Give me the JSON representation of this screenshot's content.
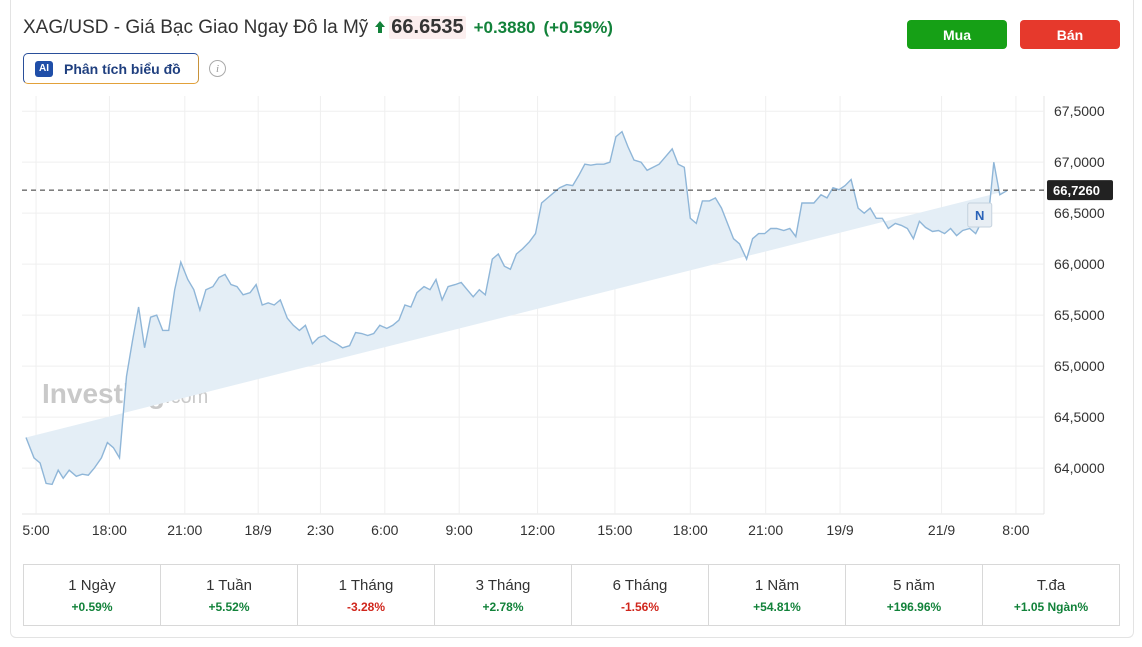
{
  "header": {
    "title": "XAG/USD - Giá Bạc Giao Ngay Đô la Mỹ",
    "price": "66.6535",
    "change": "+0.3880",
    "change_pct": "(+0.59%)",
    "buy_label": "Mua",
    "sell_label": "Bán",
    "ai_icon_text": "AI",
    "ai_label": "Phân tích biểu đồ",
    "info_icon_text": "i"
  },
  "colors": {
    "up": "#12823a",
    "down": "#d0261c",
    "line": "#8fb6d8",
    "fill": "#e4eef6",
    "buy": "#16a016",
    "sell": "#e6392c"
  },
  "chart_data": {
    "type": "area",
    "ylim": [
      63.55,
      67.6
    ],
    "yticks": [
      "67,5000",
      "67,0000",
      "66,5000",
      "66,0000",
      "65,5000",
      "65,0000",
      "64,5000",
      "64,0000"
    ],
    "ytick_values": [
      67.5,
      67.0,
      66.5,
      66.0,
      65.5,
      65.0,
      64.5,
      64.0
    ],
    "xlim": [
      0,
      100
    ],
    "xticks": [
      "5:00",
      "18:00",
      "21:00",
      "18/9",
      "2:30",
      "6:00",
      "9:00",
      "12:00",
      "15:00",
      "18:00",
      "21:00",
      "19/9",
      "21/9",
      "8:00"
    ],
    "xtick_positions": [
      1.0,
      8.3,
      15.8,
      23.1,
      29.3,
      35.7,
      43.1,
      50.9,
      58.6,
      66.1,
      73.6,
      81.0,
      91.1,
      98.5
    ],
    "current_value": "66,7260",
    "current_level": 66.726,
    "marker_label": "N",
    "grid": true,
    "watermark_main": "Investing",
    "watermark_suffix": ".com",
    "x": [
      0.0,
      0.8,
      1.4,
      2.0,
      2.6,
      3.2,
      3.7,
      4.3,
      5.0,
      5.6,
      6.2,
      6.8,
      7.5,
      8.1,
      8.7,
      9.3,
      10.0,
      10.6,
      11.2,
      11.8,
      12.4,
      13.0,
      13.6,
      14.2,
      14.8,
      15.4,
      16.1,
      16.7,
      17.3,
      17.9,
      18.6,
      19.2,
      19.8,
      20.4,
      21.0,
      21.6,
      22.3,
      22.9,
      23.5,
      24.1,
      24.7,
      25.3,
      26.0,
      26.6,
      27.2,
      27.8,
      28.5,
      29.1,
      29.7,
      30.3,
      30.9,
      31.5,
      32.2,
      32.8,
      33.4,
      34.0,
      34.6,
      35.2,
      35.9,
      36.5,
      37.1,
      37.7,
      38.3,
      38.9,
      39.6,
      40.2,
      40.8,
      41.4,
      42.0,
      42.7,
      43.3,
      43.9,
      44.5,
      45.1,
      45.7,
      46.4,
      47.0,
      47.6,
      48.2,
      48.8,
      49.4,
      50.1,
      50.7,
      51.3,
      51.9,
      52.5,
      53.1,
      53.8,
      54.4,
      55.0,
      55.6,
      56.2,
      56.8,
      57.5,
      58.1,
      58.7,
      59.3,
      59.9,
      60.5,
      61.2,
      61.8,
      62.4,
      63.0,
      63.6,
      64.3,
      64.9,
      65.5,
      66.1,
      66.7,
      67.3,
      68.0,
      68.6,
      69.2,
      69.8,
      70.4,
      71.0,
      71.7,
      72.3,
      72.9,
      73.5,
      74.1,
      74.7,
      75.4,
      76.0,
      76.6,
      77.2,
      77.8,
      78.4,
      79.1,
      79.7,
      80.3,
      80.9,
      81.5,
      82.1,
      82.8,
      83.4,
      84.0,
      84.6,
      85.2,
      85.8,
      86.5,
      87.1,
      87.7,
      88.3,
      88.9,
      89.5,
      90.2,
      90.8,
      91.4,
      92.0,
      92.6,
      93.2,
      93.9,
      94.5,
      95.1,
      95.7,
      96.3,
      96.9,
      97.6,
      98.2,
      98.8,
      99.4,
      100.0
    ],
    "y": [
      64.3,
      64.1,
      64.05,
      63.85,
      63.84,
      63.98,
      63.9,
      63.98,
      63.92,
      63.94,
      63.93,
      64.0,
      64.1,
      64.25,
      64.2,
      64.1,
      64.9,
      65.25,
      65.58,
      65.18,
      65.48,
      65.5,
      65.35,
      65.35,
      65.75,
      66.02,
      65.85,
      65.75,
      65.55,
      65.75,
      65.78,
      65.87,
      65.9,
      65.8,
      65.78,
      65.7,
      65.72,
      65.8,
      65.6,
      65.62,
      65.6,
      65.65,
      65.47,
      65.4,
      65.35,
      65.4,
      65.22,
      65.28,
      65.3,
      65.25,
      65.22,
      65.18,
      65.2,
      65.33,
      65.32,
      65.3,
      65.32,
      65.4,
      65.37,
      65.4,
      65.45,
      65.6,
      65.58,
      65.72,
      65.78,
      65.75,
      65.85,
      65.65,
      65.78,
      65.8,
      65.82,
      65.75,
      65.68,
      65.75,
      65.7,
      66.05,
      66.1,
      65.98,
      65.95,
      66.1,
      66.15,
      66.22,
      66.3,
      66.6,
      66.65,
      66.7,
      66.75,
      66.78,
      66.77,
      66.87,
      66.98,
      66.97,
      66.98,
      66.98,
      67.0,
      67.25,
      67.3,
      67.15,
      67.02,
      67.0,
      66.92,
      66.95,
      66.98,
      67.05,
      67.13,
      66.98,
      66.95,
      66.45,
      66.4,
      66.62,
      66.62,
      66.65,
      66.55,
      66.4,
      66.25,
      66.2,
      66.05,
      66.25,
      66.3,
      66.3,
      66.35,
      66.35,
      66.33,
      66.35,
      66.27,
      66.6,
      66.6,
      66.6,
      66.68,
      66.65,
      66.75,
      66.73,
      66.77,
      66.83,
      66.55,
      66.5,
      66.55,
      66.45,
      66.45,
      66.35,
      66.4,
      66.38,
      66.35,
      66.25,
      66.42,
      66.36,
      66.32,
      66.33,
      66.3,
      66.35,
      66.28,
      66.33,
      66.35,
      66.3,
      66.42,
      66.4,
      67.0,
      66.68,
      66.72
    ]
  },
  "periods": [
    {
      "label": "1 Ngày",
      "value": "+0.59%",
      "dir": "pos"
    },
    {
      "label": "1 Tuần",
      "value": "+5.52%",
      "dir": "pos"
    },
    {
      "label": "1 Tháng",
      "value": "-3.28%",
      "dir": "neg"
    },
    {
      "label": "3 Tháng",
      "value": "+2.78%",
      "dir": "pos"
    },
    {
      "label": "6 Tháng",
      "value": "-1.56%",
      "dir": "neg"
    },
    {
      "label": "1 Năm",
      "value": "+54.81%",
      "dir": "pos"
    },
    {
      "label": "5 năm",
      "value": "+196.96%",
      "dir": "pos"
    },
    {
      "label": "T.đa",
      "value": "+1.05 Ngàn%",
      "dir": "pos"
    }
  ]
}
